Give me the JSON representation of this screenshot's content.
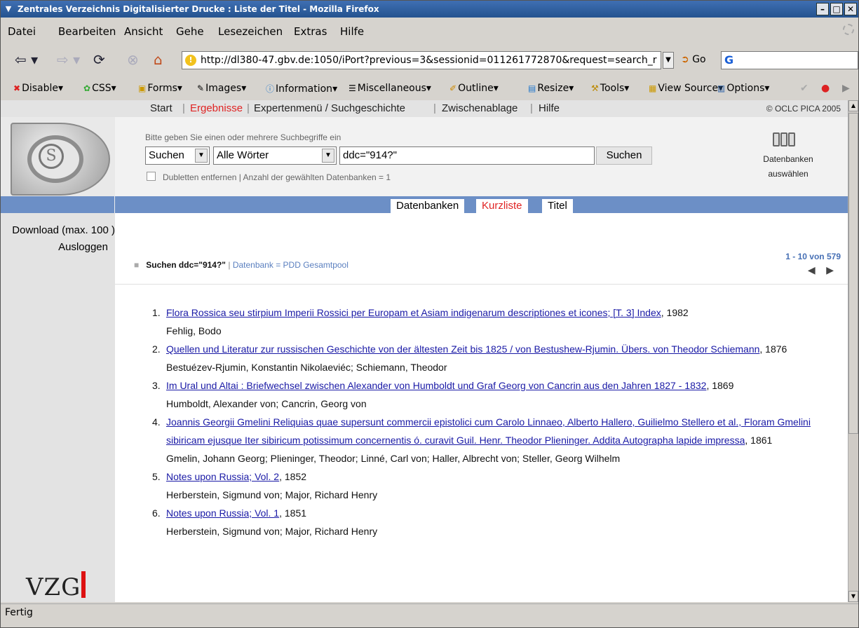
{
  "window": {
    "title": "Zentrales Verzeichnis Digitalisierter Drucke : Liste der Titel - Mozilla Firefox"
  },
  "menu": [
    "Datei",
    "Bearbeiten",
    "Ansicht",
    "Gehe",
    "Lesezeichen",
    "Extras",
    "Hilfe"
  ],
  "nav": {
    "url": "http://dl380-47.gbv.de:1050/iPort?previous=3&sessionid=011261772870&request=search_r",
    "go_label": "Go"
  },
  "devtoolbar": [
    "Disable",
    "CSS",
    "Forms",
    "Images",
    "Information",
    "Miscellaneous",
    "Outline",
    "Resize",
    "Tools",
    "View Source",
    "Options"
  ],
  "topnav": {
    "items": [
      "Start",
      "Ergebnisse",
      "Expertenmenü / Suchgeschichte",
      "Zwischenablage",
      "Hilfe"
    ],
    "copyright": "© OCLC PICA 2005"
  },
  "search": {
    "hint": "Bitte geben Sie einen oder mehrere Suchbegriffe ein",
    "action_select": "Suchen",
    "mode_select": "Alle Wörter",
    "query": "ddc=\"914?\"",
    "button": "Suchen",
    "dubletten": "Dubletten entfernen | Anzahl der gewählten Datenbanken = 1",
    "db_label": "Datenbanken auswählen"
  },
  "tabs": [
    "Datenbanken",
    "Kurzliste",
    "Titel"
  ],
  "sidebar": {
    "download": "Download (max. 100 )",
    "logout": "Ausloggen",
    "vzg": "VZG"
  },
  "result_header": {
    "query_label": "Suchen ddc=\"914?\"",
    "database": "Datenbank = PDD Gesamtpool",
    "count": "1 - 10 von 579"
  },
  "results": [
    {
      "num": "1.",
      "title": "Flora Rossica seu stirpium Imperii Rossici per Europam et Asiam indigenarum descriptiones et icones; [T. 3] Index",
      "year": ", 1982",
      "authors": "Fehlig, Bodo"
    },
    {
      "num": "2.",
      "title": "Quellen und Literatur zur russischen Geschichte von der ältesten Zeit bis 1825 / von Bestushew-Rjumin. Übers. von Theodor Schiemann",
      "year": ", 1876",
      "authors": "Bestuézev-Rjumin, Konstantin Nikolaeviéc; Schiemann, Theodor"
    },
    {
      "num": "3.",
      "title": "Im Ural und Altai : Briefwechsel zwischen Alexander von Humboldt und Graf Georg von Cancrin aus den Jahren 1827 - 1832",
      "year": ", 1869",
      "authors": "Humboldt, Alexander von; Cancrin, Georg von"
    },
    {
      "num": "4.",
      "title": "Joannis Georgii Gmelini Reliquias quae supersunt commercii epistolici cum Carolo Linnaeo, Alberto Hallero, Guilielmo Stellero et al., Floram Gmelini sibiricam ejusque Iter sibiricum potissimum concernentis ó. curavit Guil. Henr. Theodor Plieninger. Addita Autographa lapide impressa",
      "year": ", 1861",
      "authors": "Gmelin, Johann Georg; Plieninger, Theodor; Linné, Carl von; Haller, Albrecht von; Steller, Georg Wilhelm"
    },
    {
      "num": "5.",
      "title": "Notes upon Russia; Vol. 2",
      "year": ", 1852",
      "authors": "Herberstein, Sigmund von; Major, Richard Henry"
    },
    {
      "num": "6.",
      "title": "Notes upon Russia; Vol. 1",
      "year": ", 1851",
      "authors": "Herberstein, Sigmund von; Major, Richard Henry"
    }
  ],
  "status": "Fertig"
}
